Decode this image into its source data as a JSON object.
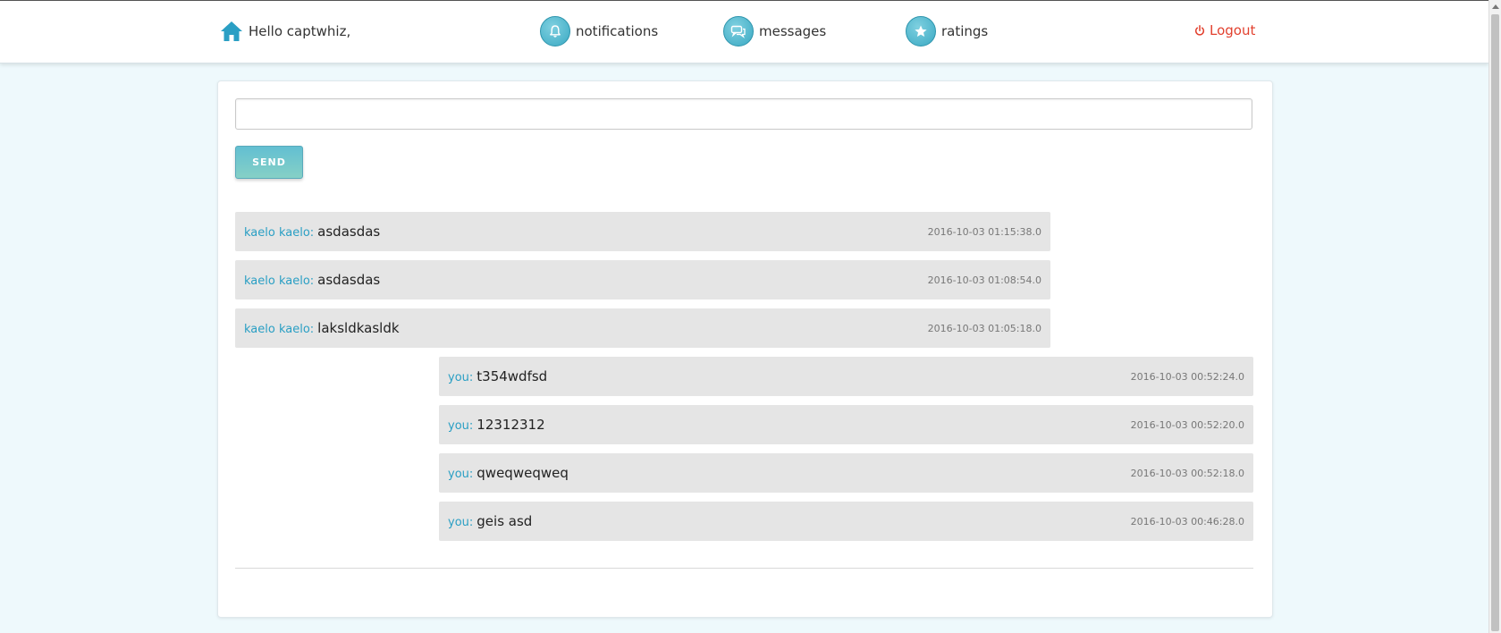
{
  "header": {
    "greeting": "Hello captwhiz,",
    "nav": [
      {
        "label": "notifications",
        "icon": "bell-icon"
      },
      {
        "label": "messages",
        "icon": "chat-bubbles-icon"
      },
      {
        "label": "ratings",
        "icon": "star-icon"
      }
    ],
    "logout_label": "Logout"
  },
  "composer": {
    "input_value": "",
    "send_label": "SEND"
  },
  "messages": [
    {
      "sender": "kaelo kaelo:",
      "text": "asdasdas",
      "time": "2016-10-03 01:15:38.0",
      "mine": false
    },
    {
      "sender": "kaelo kaelo:",
      "text": "asdasdas",
      "time": "2016-10-03 01:08:54.0",
      "mine": false
    },
    {
      "sender": "kaelo kaelo:",
      "text": "laksldkasldk",
      "time": "2016-10-03 01:05:18.0",
      "mine": false
    },
    {
      "sender": "you:",
      "text": "t354wdfsd",
      "time": "2016-10-03 00:52:24.0",
      "mine": true
    },
    {
      "sender": "you:",
      "text": "12312312",
      "time": "2016-10-03 00:52:20.0",
      "mine": true
    },
    {
      "sender": "you:",
      "text": "qweqweqweq",
      "time": "2016-10-03 00:52:18.0",
      "mine": true
    },
    {
      "sender": "you:",
      "text": "geis asd",
      "time": "2016-10-03 00:46:28.0",
      "mine": true
    }
  ],
  "colors": {
    "accent": "#2a9fc4",
    "logout": "#e2412f",
    "bubble": "#e5e5e5",
    "page_bg": "#eef9fc"
  }
}
